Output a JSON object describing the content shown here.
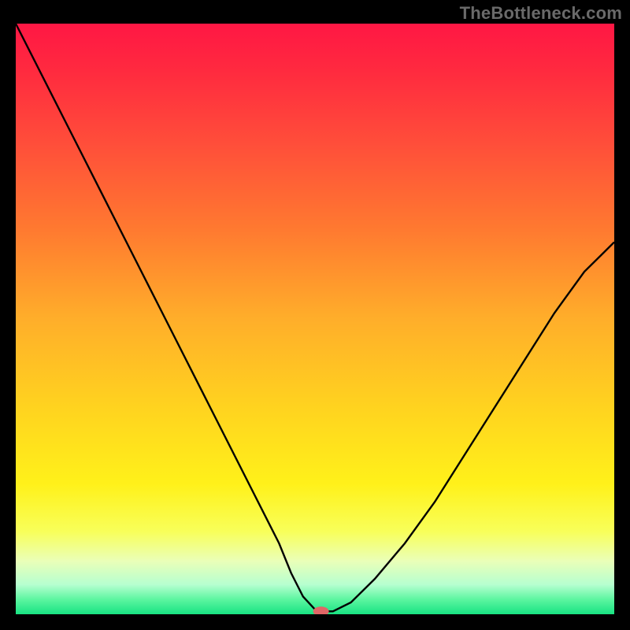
{
  "watermark": "TheBottleneck.com",
  "chart_data": {
    "type": "line",
    "title": "",
    "xlabel": "",
    "ylabel": "",
    "xlim": [
      0,
      100
    ],
    "ylim": [
      0,
      100
    ],
    "grid": false,
    "background_gradient": {
      "stops": [
        {
          "offset": 0.0,
          "color": "#ff1744"
        },
        {
          "offset": 0.08,
          "color": "#ff2a3f"
        },
        {
          "offset": 0.2,
          "color": "#ff4d3a"
        },
        {
          "offset": 0.35,
          "color": "#ff7a30"
        },
        {
          "offset": 0.5,
          "color": "#ffae2a"
        },
        {
          "offset": 0.65,
          "color": "#ffd31f"
        },
        {
          "offset": 0.78,
          "color": "#fff11a"
        },
        {
          "offset": 0.86,
          "color": "#f8ff5a"
        },
        {
          "offset": 0.91,
          "color": "#eaffb8"
        },
        {
          "offset": 0.95,
          "color": "#b6ffd0"
        },
        {
          "offset": 0.975,
          "color": "#5cf5a0"
        },
        {
          "offset": 1.0,
          "color": "#18e382"
        }
      ]
    },
    "series": [
      {
        "name": "curve",
        "color": "#000000",
        "stroke_width": 2.4,
        "x": [
          0,
          4,
          8,
          12,
          16,
          20,
          24,
          28,
          32,
          36,
          40,
          44,
          46,
          48,
          50,
          51,
          53,
          56,
          60,
          65,
          70,
          75,
          80,
          85,
          90,
          95,
          100
        ],
        "y": [
          100,
          92,
          84,
          76,
          68,
          60,
          52,
          44,
          36,
          28,
          20,
          12,
          7,
          3,
          0.8,
          0.5,
          0.5,
          2,
          6,
          12,
          19,
          27,
          35,
          43,
          51,
          58,
          63
        ]
      }
    ],
    "marker": {
      "name": "target-marker",
      "x": 51,
      "y": 0.5,
      "color": "#e06666",
      "rx": 10,
      "ry": 6
    }
  }
}
